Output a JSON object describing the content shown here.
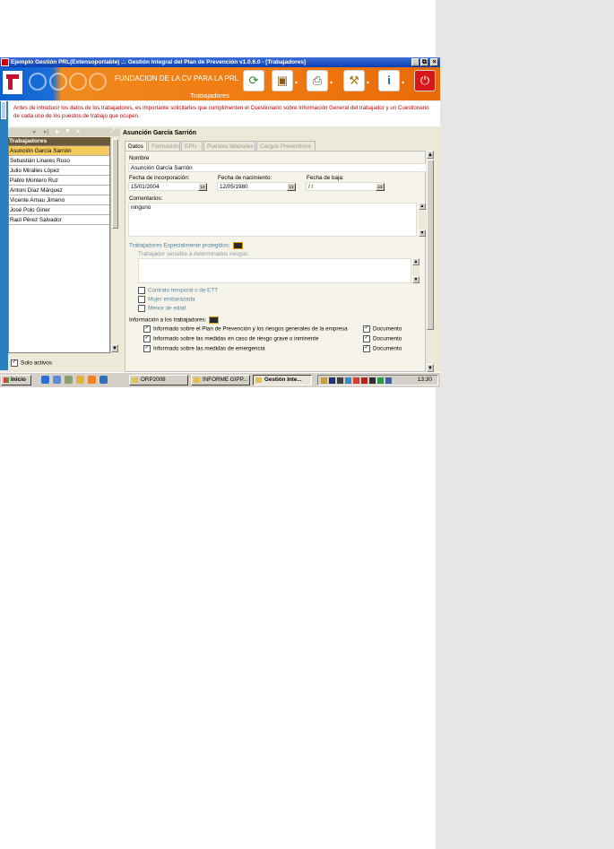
{
  "window": {
    "title": "Ejemplo Gestión PRL(Extensoportable) .:. Gestión Integral del Plan de Prevención v1.0.6.0 - [Trabajadores]",
    "controls": [
      "_",
      "⧉",
      "×"
    ]
  },
  "banner": {
    "title": "FUNDACION DE LA CV PARA LA PRL",
    "subtitle": "Trabajadores",
    "toolbar_icons": [
      "refresh-icon",
      "briefcase-icon",
      "printer-icon",
      "tools-icon",
      "info-icon",
      "power-icon"
    ]
  },
  "notice": "Antes de introducir los datos de los trabajadores, es importante solicitarles que cumplimenten el Cuestionario sobre Información General del trabajador y un Cuestionario de cada uno de los puestos de trabajo que ocupen.",
  "list_panel": {
    "header": "Trabajadores",
    "items": [
      "Asunción García Sarrión",
      "Sebastián Linares Ruso",
      "Julio Miralles López",
      "Pablo Montero Ruz",
      "Antoni Díaz Márquez",
      "Vicente Arnau Jimeno",
      "José Polo Giner",
      "Raúl Pérez Salvador"
    ],
    "selected_index": 0,
    "solo_activos": "Solo activos",
    "solo_activos_checked": true
  },
  "detail": {
    "worker_name": "Asunción García Sarrión",
    "tabs": [
      "Datos",
      "Formación",
      "EPIs",
      "Puestos laborales",
      "Cargos Preventivos"
    ],
    "active_tab": "Datos",
    "nombre_label": "Nombre",
    "nombre_value": "Asunción García Sarrión",
    "fecha_incorporacion_label": "Fecha de incorporación:",
    "fecha_incorporacion_value": "15/01/2004",
    "fecha_nacimiento_label": "Fecha de nacimiento:",
    "fecha_nacimiento_value": "12/05/1980",
    "fecha_baja_label": "Fecha de baja:",
    "fecha_baja_value": " /  /",
    "calendar_label": "13",
    "comentarios_label": "Comentarios:",
    "comentarios_value": "ninguno",
    "protegidos_label": "Trabajadores Especialmente protegidos:",
    "sensible_label": "Trabajador sensible a determinados riesgos:",
    "contrato_label": "Contrato temporal o de ETT",
    "embarazada_label": "Mujer embarazada",
    "menor_label": "Menor de edad",
    "info_label": "Información a los trabajadores:",
    "info_items": [
      {
        "text": "Informado sobre el Plan de Prevención y los riesgos generales de la empresa",
        "checked": true,
        "doc": "Documento",
        "doc_checked": true
      },
      {
        "text": "Informado sobre las medidas en caso de riesgo grave o inminente",
        "checked": true,
        "doc": "Documento",
        "doc_checked": true
      },
      {
        "text": "Informado sobre las medidas de emergencia",
        "checked": true,
        "doc": "Documento",
        "doc_checked": true
      }
    ]
  },
  "taskbar": {
    "start": "Inicio",
    "buttons": [
      "ORP2008",
      "INFORME GIPP...",
      "Gestión Inte..."
    ],
    "active_button": 2,
    "clock": "13:30"
  }
}
